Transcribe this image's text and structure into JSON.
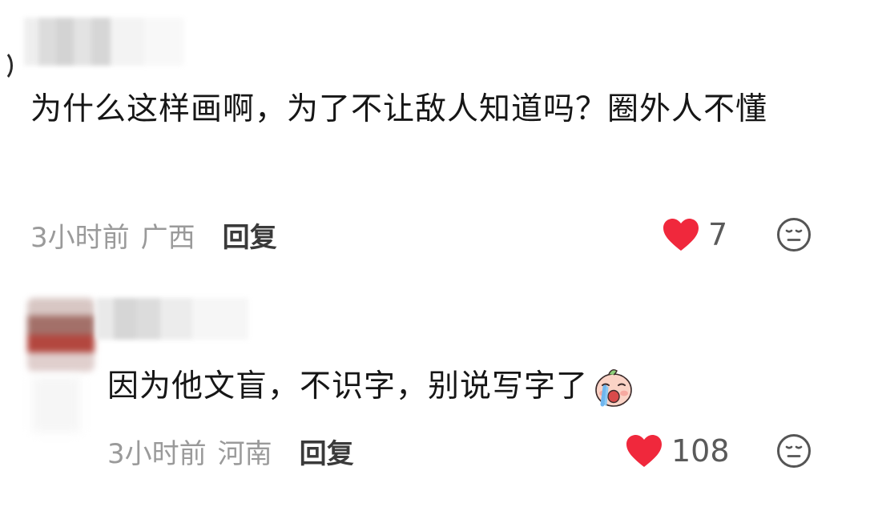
{
  "comments": [
    {
      "text": "为什么这样画啊，为了不让敌人知道吗？圈外人不懂",
      "time": "3小时前",
      "location": "广西",
      "reply_label": "回复",
      "likes": "7"
    },
    {
      "text": "因为他文盲，不识字，别说写字了",
      "time": "3小时前",
      "location": "河南",
      "reply_label": "回复",
      "likes": "108",
      "trailing_emoji": "crying-baby-sticker"
    }
  ],
  "icons": {
    "like": "heart-icon",
    "dislike": "expressionless-face-icon"
  },
  "colors": {
    "heart": "#f0283c",
    "text": "#161616",
    "meta": "#9a9a9a",
    "reply": "#3a3a3a"
  }
}
